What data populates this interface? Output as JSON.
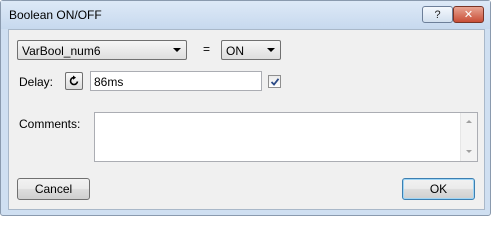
{
  "window": {
    "title": "Boolean ON/OFF",
    "help_label": "?",
    "close_label": "✕"
  },
  "condition": {
    "variable": "VarBool_num6",
    "operator": "=",
    "value": "ON"
  },
  "delay": {
    "label": "Delay:",
    "value": "86ms",
    "checked": true
  },
  "comments": {
    "label": "Comments:",
    "value": ""
  },
  "buttons": {
    "cancel": "Cancel",
    "ok": "OK"
  },
  "icons": {
    "refresh": "refresh-icon",
    "check": "checkmark-icon"
  }
}
